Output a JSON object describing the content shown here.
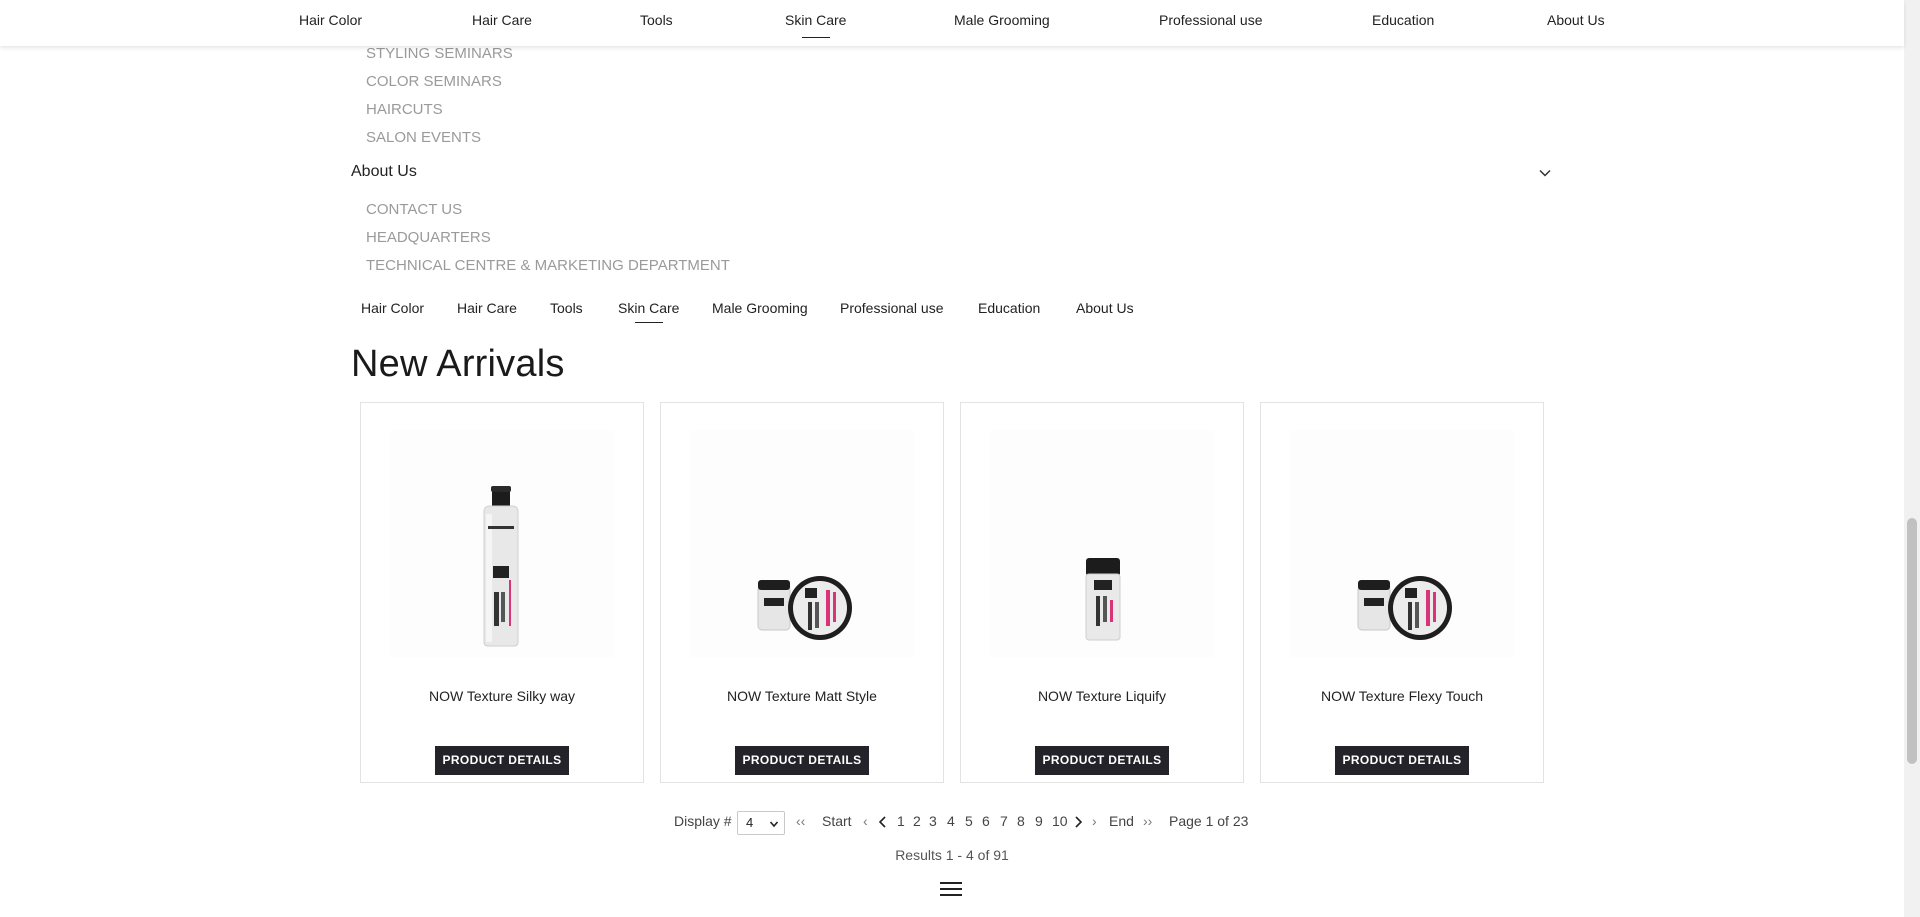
{
  "top_nav": {
    "items": [
      {
        "label": "Hair Color"
      },
      {
        "label": "Hair Care"
      },
      {
        "label": "Tools"
      },
      {
        "label": "Skin Care",
        "active": true
      },
      {
        "label": "Male Grooming"
      },
      {
        "label": "Professional use"
      },
      {
        "label": "Education"
      },
      {
        "label": "About Us"
      }
    ]
  },
  "footer_menu": {
    "education_links": [
      "STYLING SEMINARS",
      "COLOR SEMINARS",
      "HAIRCUTS",
      "SALON EVENTS"
    ],
    "about_title": "About Us",
    "about_icon": "chevron-down-icon",
    "about_links": [
      "CONTACT US",
      "HEADQUARTERS",
      "TECHNICAL CENTRE & MARKETING DEPARTMENT"
    ]
  },
  "category_nav": {
    "items": [
      {
        "label": "Hair Color"
      },
      {
        "label": "Hair Care"
      },
      {
        "label": "Tools"
      },
      {
        "label": "Skin Care",
        "active": true
      },
      {
        "label": "Male Grooming"
      },
      {
        "label": "Professional use"
      },
      {
        "label": "Education"
      },
      {
        "label": "About Us"
      }
    ]
  },
  "new_arrivals": {
    "heading": "New Arrivals",
    "products": [
      {
        "name": "NOW Texture Silky way",
        "button": "PRODUCT DETAILS"
      },
      {
        "name": "NOW Texture Matt Style",
        "button": "PRODUCT DETAILS"
      },
      {
        "name": "NOW Texture Liquify",
        "button": "PRODUCT DETAILS"
      },
      {
        "name": "NOW Texture Flexy Touch",
        "button": "PRODUCT DETAILS"
      }
    ]
  },
  "pagination": {
    "display_label": "Display #",
    "display_value": "4",
    "first": "‹‹",
    "start": "Start",
    "prev": "‹",
    "pages": [
      "1",
      "2",
      "3",
      "4",
      "5",
      "6",
      "7",
      "8",
      "9",
      "10"
    ],
    "next": "›",
    "end": "End",
    "last": "››",
    "page_info": "Page 1 of 23",
    "results": "Results 1 - 4 of 91"
  },
  "colors": {
    "button_bg": "#24232a",
    "muted_text": "#9a9a9a"
  }
}
